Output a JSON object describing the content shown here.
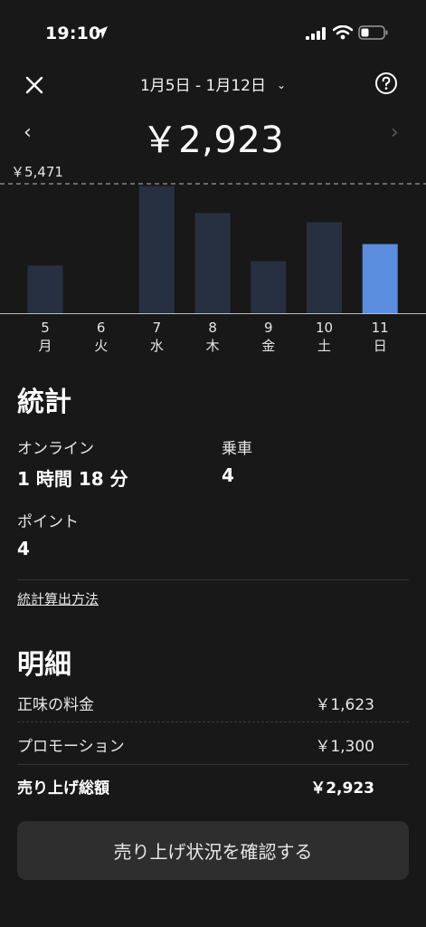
{
  "status_bar": {
    "time": "19:10"
  },
  "header": {
    "date_range": "1月5日 - 1月12日",
    "chevron": "⌄"
  },
  "summary": {
    "total": "￥2,923",
    "prev": "‹",
    "next": "›"
  },
  "chart_data": {
    "type": "bar",
    "max_label": "￥5,471",
    "reference_line": 5471,
    "ylim": [
      0,
      5471
    ],
    "categories": [
      {
        "day": "5",
        "weekday": "月"
      },
      {
        "day": "6",
        "weekday": "火"
      },
      {
        "day": "7",
        "weekday": "水"
      },
      {
        "day": "8",
        "weekday": "木"
      },
      {
        "day": "9",
        "weekday": "金"
      },
      {
        "day": "10",
        "weekday": "土"
      },
      {
        "day": "11",
        "weekday": "日"
      }
    ],
    "values": [
      2020,
      0,
      5380,
      4230,
      2200,
      3850,
      2923
    ],
    "selected_index": 6,
    "colors": {
      "bar": "#263040",
      "selected": "#5b8ddf",
      "reference": "#9a9a9a"
    }
  },
  "stats": {
    "title": "統計",
    "online_label": "オンライン",
    "online_value": "1 時間 18 分",
    "rides_label": "乗車",
    "rides_value": "4",
    "points_label": "ポイント",
    "points_value": "4",
    "method_link": "統計算出方法"
  },
  "breakdown": {
    "title": "明細",
    "rows": [
      {
        "label": "正味の料金",
        "value": "￥1,623"
      },
      {
        "label": "プロモーション",
        "value": "￥1,300"
      },
      {
        "label": "売り上げ総額",
        "value": "￥2,923"
      }
    ]
  },
  "cta": {
    "label": "売り上げ状況を確認する"
  }
}
